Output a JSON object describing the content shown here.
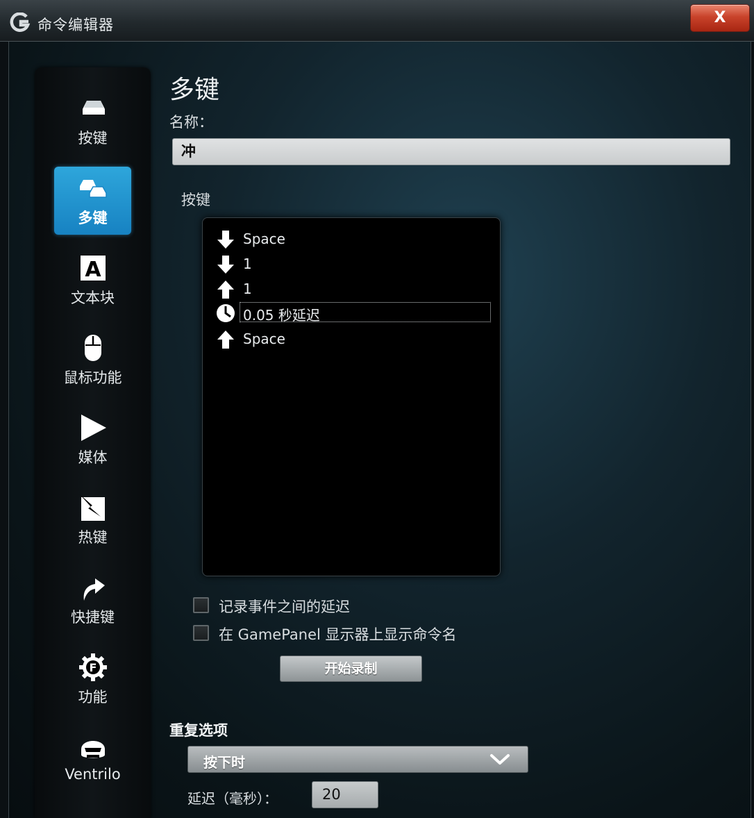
{
  "window": {
    "title": "命令编辑器",
    "close_label": "X"
  },
  "sidebar": {
    "items": [
      {
        "label": "按键",
        "icon": "key-icon"
      },
      {
        "label": "多键",
        "icon": "multi-key-icon",
        "active": true
      },
      {
        "label": "文本块",
        "icon": "text-block-icon"
      },
      {
        "label": "鼠标功能",
        "icon": "mouse-icon"
      },
      {
        "label": "媒体",
        "icon": "play-icon"
      },
      {
        "label": "热键",
        "icon": "hotkey-icon"
      },
      {
        "label": "快捷键",
        "icon": "shortcut-arrow-icon"
      },
      {
        "label": "功能",
        "icon": "function-gear-icon"
      },
      {
        "label": "Ventrilo",
        "icon": "headset-icon"
      }
    ]
  },
  "main": {
    "heading": "多键",
    "name_label": "名称：",
    "name_value": "冲",
    "keys_label": "按键",
    "key_events": [
      {
        "icon": "arrow-down-icon",
        "text": "Space"
      },
      {
        "icon": "arrow-down-icon",
        "text": "1"
      },
      {
        "icon": "arrow-up-icon",
        "text": "1"
      },
      {
        "icon": "clock-icon",
        "text": "0.05 秒延迟",
        "selected": true
      },
      {
        "icon": "arrow-up-icon",
        "text": "Space"
      }
    ],
    "checkbox_record_delay": {
      "label": "记录事件之间的延迟",
      "checked": false
    },
    "checkbox_gamepanel": {
      "label": "在 GamePanel 显示器上显示命令名",
      "checked": false
    },
    "record_button": "开始录制",
    "repeat_label": "重复选项",
    "repeat_value": "按下时",
    "delay_label": "延迟（毫秒）：",
    "delay_value": "20"
  },
  "colors": {
    "accent": "#1e8fcf",
    "close_red": "#c9432b"
  }
}
